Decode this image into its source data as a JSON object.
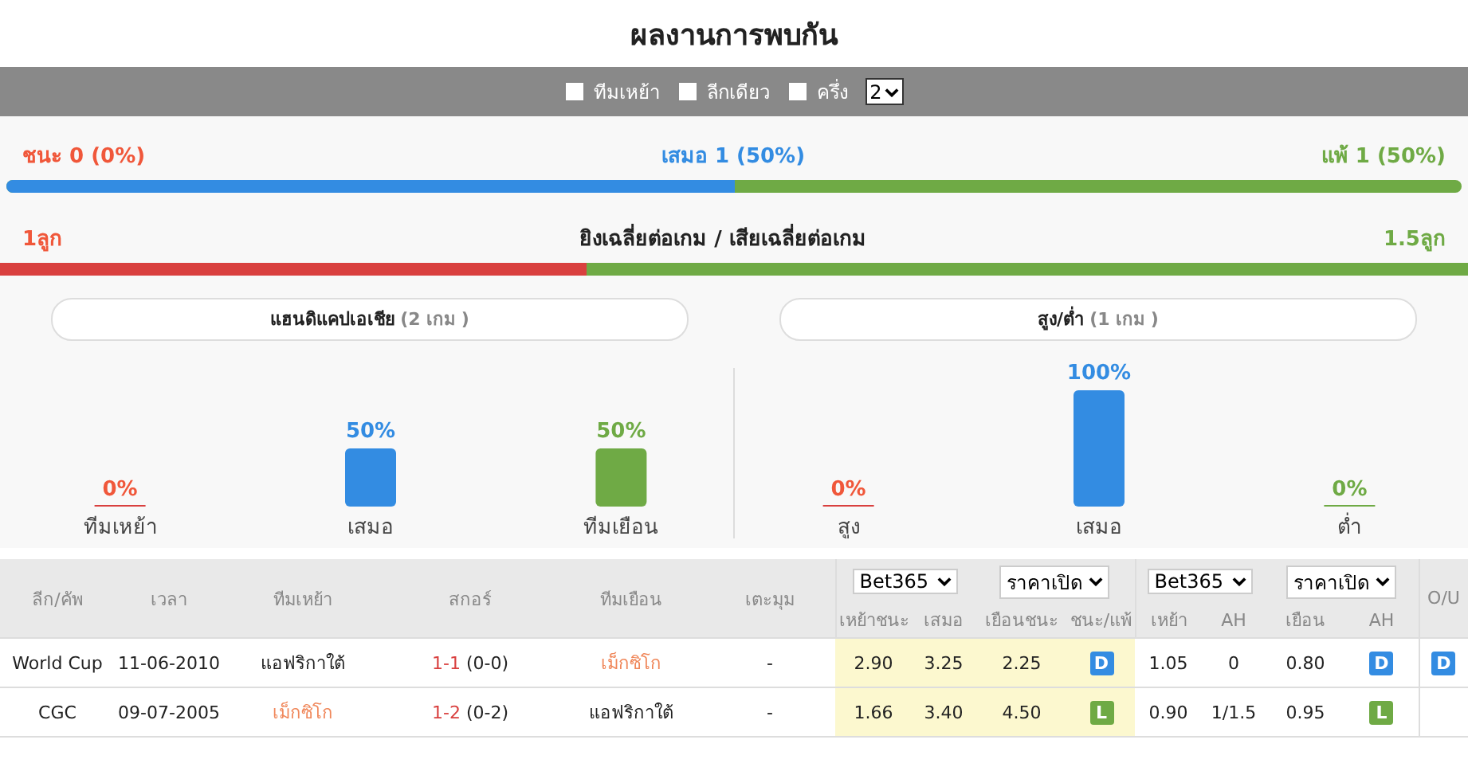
{
  "title": "ผลงานการพบกัน",
  "filters": [
    {
      "label": "ทีมเหย้า",
      "checked": false
    },
    {
      "label": "ลีกเดียว",
      "checked": false
    },
    {
      "label": "ครึ่ง",
      "checked": false
    }
  ],
  "count_select": {
    "value": "2"
  },
  "results": {
    "win": "ชนะ 0 (0%)",
    "draw": "เสมอ 1 (50%)",
    "loss": "แพ้ 1 (50%)",
    "level": 0.5
  },
  "goals": {
    "left": "1ลูก",
    "label": "ยิงเฉลี่ยต่อเกม / เสียเฉลี่ยต่อเกม",
    "right": "1.5ลูก",
    "level": 0.4
  },
  "panels": [
    {
      "title": "แฮนดิแคปเอเชีย",
      "count": "(2 เกม )",
      "chart_data": {
        "type": "bar",
        "categories": [
          "ทีมเหย้า",
          "เสมอ",
          "ทีมเยือน"
        ],
        "values": [
          0,
          50,
          50
        ],
        "value_labels": [
          "0%",
          "50%",
          "50%"
        ]
      }
    },
    {
      "title": "สูง/ต่ำ",
      "count": "(1 เกม )",
      "chart_data": {
        "type": "bar",
        "categories": [
          "สูง",
          "เสมอ",
          "ต่ำ"
        ],
        "values": [
          0,
          100,
          0
        ],
        "value_labels": [
          "0%",
          "100%",
          "0%"
        ]
      }
    }
  ],
  "table": {
    "columns": [
      "ลีก/คัพ",
      "เวลา",
      "ทีมเหย้า",
      "สกอร์",
      "ทีมเยือน",
      "เตะมุม"
    ],
    "odds_groups": [
      {
        "bookmaker": "Bet365",
        "price": "ราคาเปิด",
        "columns": [
          "เหย้าชนะ",
          "เสมอ",
          "เยือนชนะ",
          "ชนะ/แพ้"
        ]
      },
      {
        "bookmaker": "Bet365",
        "price": "ราคาเปิด",
        "columns": [
          "เหย้า",
          "AH",
          "เยือน",
          "AH"
        ]
      }
    ],
    "ou_column": "O/U",
    "rows": [
      {
        "league": "World Cup",
        "date": "11-06-2010",
        "home": "แอฟริกาใต้",
        "home_highlight": false,
        "score": "1-1",
        "half": "(0-0)",
        "away": "เม็กซิโก",
        "away_highlight": true,
        "corner": "-",
        "odds": [
          "2.90",
          "3.25",
          "2.25"
        ],
        "result": {
          "kind": "draw",
          "text": "D"
        },
        "ah": [
          "1.05",
          "0",
          "0.80"
        ],
        "ah_result": {
          "kind": "draw",
          "text": "D"
        },
        "ou_result": {
          "kind": "draw",
          "text": "D"
        }
      },
      {
        "league": "CGC",
        "date": "09-07-2005",
        "home": "เม็กซิโก",
        "home_highlight": true,
        "score": "1-2",
        "half": "(0-2)",
        "away": "แอฟริกาใต้",
        "away_highlight": false,
        "corner": "-",
        "odds": [
          "1.66",
          "3.40",
          "4.50"
        ],
        "result": {
          "kind": "loss",
          "text": "L"
        },
        "ah": [
          "0.90",
          "1/1.5",
          "0.95"
        ],
        "ah_result": {
          "kind": "loss",
          "text": "L"
        }
      }
    ]
  }
}
